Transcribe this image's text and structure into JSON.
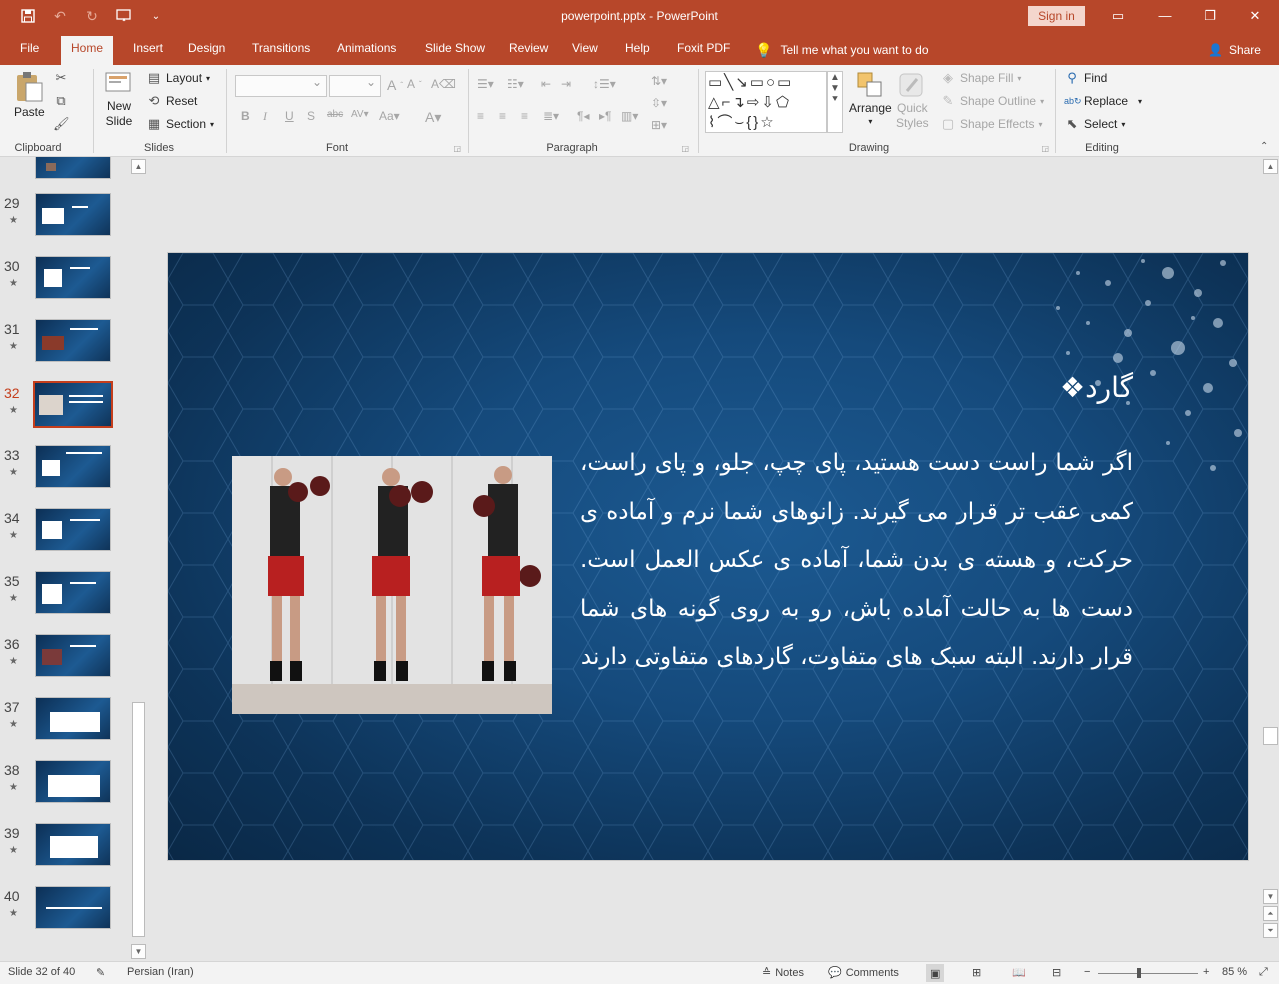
{
  "app": {
    "doc_title": "powerpoint.pptx  -  PowerPoint",
    "signin_label": "Sign in",
    "share_label": "Share",
    "colors": {
      "accent": "#b7472a",
      "selected_thumb": "#c43e1c",
      "slide_bg": "#154a7c"
    }
  },
  "tabs": [
    {
      "label": "File"
    },
    {
      "label": "Home"
    },
    {
      "label": "Insert"
    },
    {
      "label": "Design"
    },
    {
      "label": "Transitions"
    },
    {
      "label": "Animations"
    },
    {
      "label": "Slide Show"
    },
    {
      "label": "Review"
    },
    {
      "label": "View"
    },
    {
      "label": "Help"
    },
    {
      "label": "Foxit PDF"
    }
  ],
  "tell_me": "Tell me what you want to do",
  "ribbon": {
    "clipboard": {
      "paste": "Paste",
      "group": "Clipboard"
    },
    "slides": {
      "new_slide_1": "New",
      "new_slide_2": "Slide",
      "layout": "Layout",
      "reset": "Reset",
      "section": "Section",
      "group": "Slides"
    },
    "font": {
      "group": "Font"
    },
    "paragraph": {
      "group": "Paragraph"
    },
    "drawing": {
      "arrange": "Arrange",
      "quick_1": "Quick",
      "quick_2": "Styles",
      "shape_fill": "Shape Fill",
      "shape_outline": "Shape Outline",
      "shape_effects": "Shape Effects",
      "group": "Drawing"
    },
    "editing": {
      "find": "Find",
      "replace": "Replace",
      "select": "Select",
      "group": "Editing"
    }
  },
  "thumbnails": [
    {
      "num": "29"
    },
    {
      "num": "30"
    },
    {
      "num": "31"
    },
    {
      "num": "32",
      "selected": true
    },
    {
      "num": "33"
    },
    {
      "num": "34"
    },
    {
      "num": "35"
    },
    {
      "num": "36"
    },
    {
      "num": "37"
    },
    {
      "num": "38"
    },
    {
      "num": "39"
    },
    {
      "num": "40"
    }
  ],
  "slide": {
    "title": "❖گارد",
    "body": "اگر شما راست دست هستید، پای چپ، جلو، و پای راست، کمی عقب تر قرار می گیرند. زانوهای شما نرم و آماده ی حرکت، و هسته ی بدن شما، آماده ی عکس العمل است. دست ها به حالت آماده باش، رو به روی گونه های شما قرار دارند. البته سبک های متفاوت، گاردهای متفاوتی دارند"
  },
  "status": {
    "slide_info": "Slide 32 of 40",
    "language": "Persian (Iran)",
    "notes": "Notes",
    "comments": "Comments",
    "zoom": "85 %"
  }
}
